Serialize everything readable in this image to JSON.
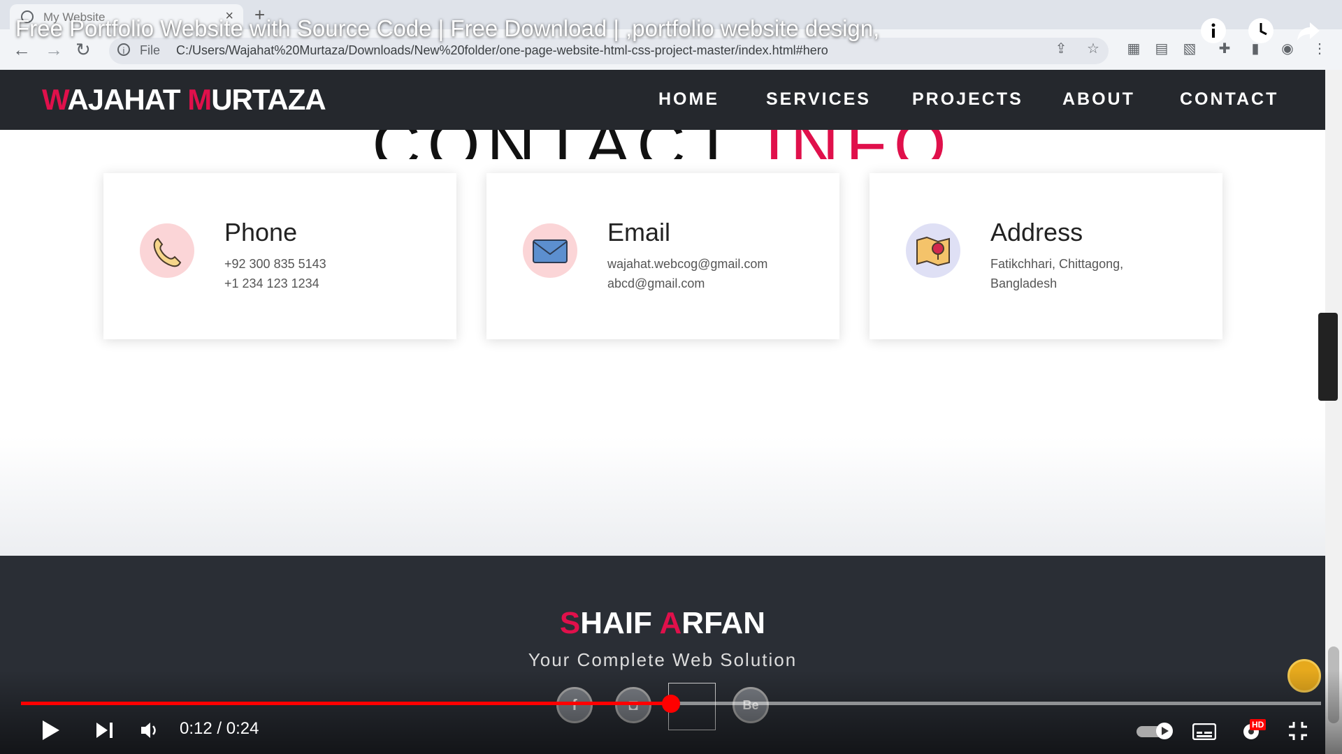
{
  "browser": {
    "tab_title": "My Website",
    "address_prefix": "File",
    "url": "C:/Users/Wajahat%20Murtaza/Downloads/New%20folder/one-page-website-html-css-project-master/index.html#hero"
  },
  "video": {
    "title": "Free Portfolio Website with Source Code | Free Download | ,portfolio website design,",
    "time": "0:12 / 0:24",
    "progress": 0.5,
    "hd_badge": "HD"
  },
  "site": {
    "logo_first_initial": "W",
    "logo_first_rest": "AJAHAT ",
    "logo_last_initial": "M",
    "logo_last_rest": "URTAZA",
    "nav": [
      "HOME",
      "SERVICES",
      "PROJECTS",
      "ABOUT",
      "CONTACT"
    ],
    "section_title_main": "CONTACT ",
    "section_title_accent": "INFO",
    "cards": [
      {
        "title": "Phone",
        "line1": "+92 300 835 5143",
        "line2": "+1 234 123 1234",
        "icon": "phone-icon"
      },
      {
        "title": "Email",
        "line1": "wajahat.webcog@gmail.com",
        "line2": "abcd@gmail.com",
        "icon": "email-icon"
      },
      {
        "title": "Address",
        "line1": "Fatikchhari, Chittagong,",
        "line2": "Bangladesh",
        "icon": "map-pin-icon"
      }
    ],
    "footer": {
      "logo_first_initial": "S",
      "logo_first_rest": "HAIF ",
      "logo_last_initial": "A",
      "logo_last_rest": "RFAN",
      "tagline": "Your Complete Web Solution",
      "social": [
        "f",
        "",
        "",
        "Be"
      ]
    }
  },
  "colors": {
    "accent": "#e0104b",
    "nav_bg": "#25282d",
    "footer_bg": "#2a2e35",
    "progress": "#ff0000"
  }
}
